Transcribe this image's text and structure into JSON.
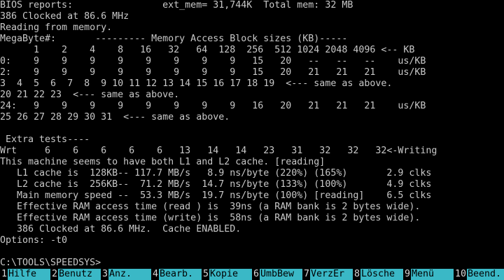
{
  "terminal": {
    "lines": [
      "BIOS reports:                ext_mem= 31,744K  Total mem: 32 MB",
      "386 Clocked at 86.6 MHz",
      "Reading from memory.",
      "MegaByte#:       --------- Memory Access Block sizes (KB)-----",
      "      1    2    4    8   16   32   64  128  256  512 1024 2048 4096 <-- KB",
      "0:    9    9    9    9    9    9    9    9   15   20   --   --   --    us/KB",
      "2:    9    9    9    9    9    9    9    9   15   20   21   21   21    us/KB",
      "3  4  5  6  7  8  9 10 11 12 13 14 15 16 17 18 19  <--- same as above.",
      "20 21 22 23  <--- same as above.",
      "24:   9    9    9    9    9    9    9    9   16   20   21   21   21    us/KB",
      "25 26 27 28 29 30 31  <--- same as above.",
      "",
      " Extra tests----",
      "Wrt     6    6    6    6    6   13   14   14   23   31   32   32   32<-Writing",
      "This machine seems to have both L1 and L2 cache. [reading]",
      "   L1 cache is  128KB-- 117.7 MB/s   8.9 ns/byte (220%) (165%)       2.9 clks",
      "   L2 cache is  256KB--  71.2 MB/s  14.7 ns/byte (133%) (100%)       4.9 clks",
      "   Main memory speed --  53.3 MB/s  19.7 ns/byte (100%) [reading]    6.5 clks",
      "   Effective RAM access time (read ) is  39ns (a RAM bank is 2 bytes wide).",
      "   Effective RAM access time (write) is  58ns (a RAM bank is 2 bytes wide).",
      "   386 Clocked at 86.6 MHz.  Cache ENABLED.",
      "Options: -t0",
      "",
      "C:\\TOOLS\\SPEEDSYS>"
    ]
  },
  "fkeys": [
    {
      "num": "1",
      "label": "Hilfe"
    },
    {
      "num": "2",
      "label": "Benutz"
    },
    {
      "num": "3",
      "label": "Anz."
    },
    {
      "num": "4",
      "label": "Bearb."
    },
    {
      "num": "5",
      "label": "Kopie"
    },
    {
      "num": "6",
      "label": "UmbBew"
    },
    {
      "num": "7",
      "label": "VerzEr"
    },
    {
      "num": "8",
      "label": "Lösche"
    },
    {
      "num": "9",
      "label": "Menü"
    },
    {
      "num": "10",
      "label": "Beend."
    }
  ],
  "colors": {
    "background": "#000000",
    "text": "#c8c8c8",
    "fkey_label_bg": "#3ab8c6",
    "fkey_label_text": "#000000"
  }
}
